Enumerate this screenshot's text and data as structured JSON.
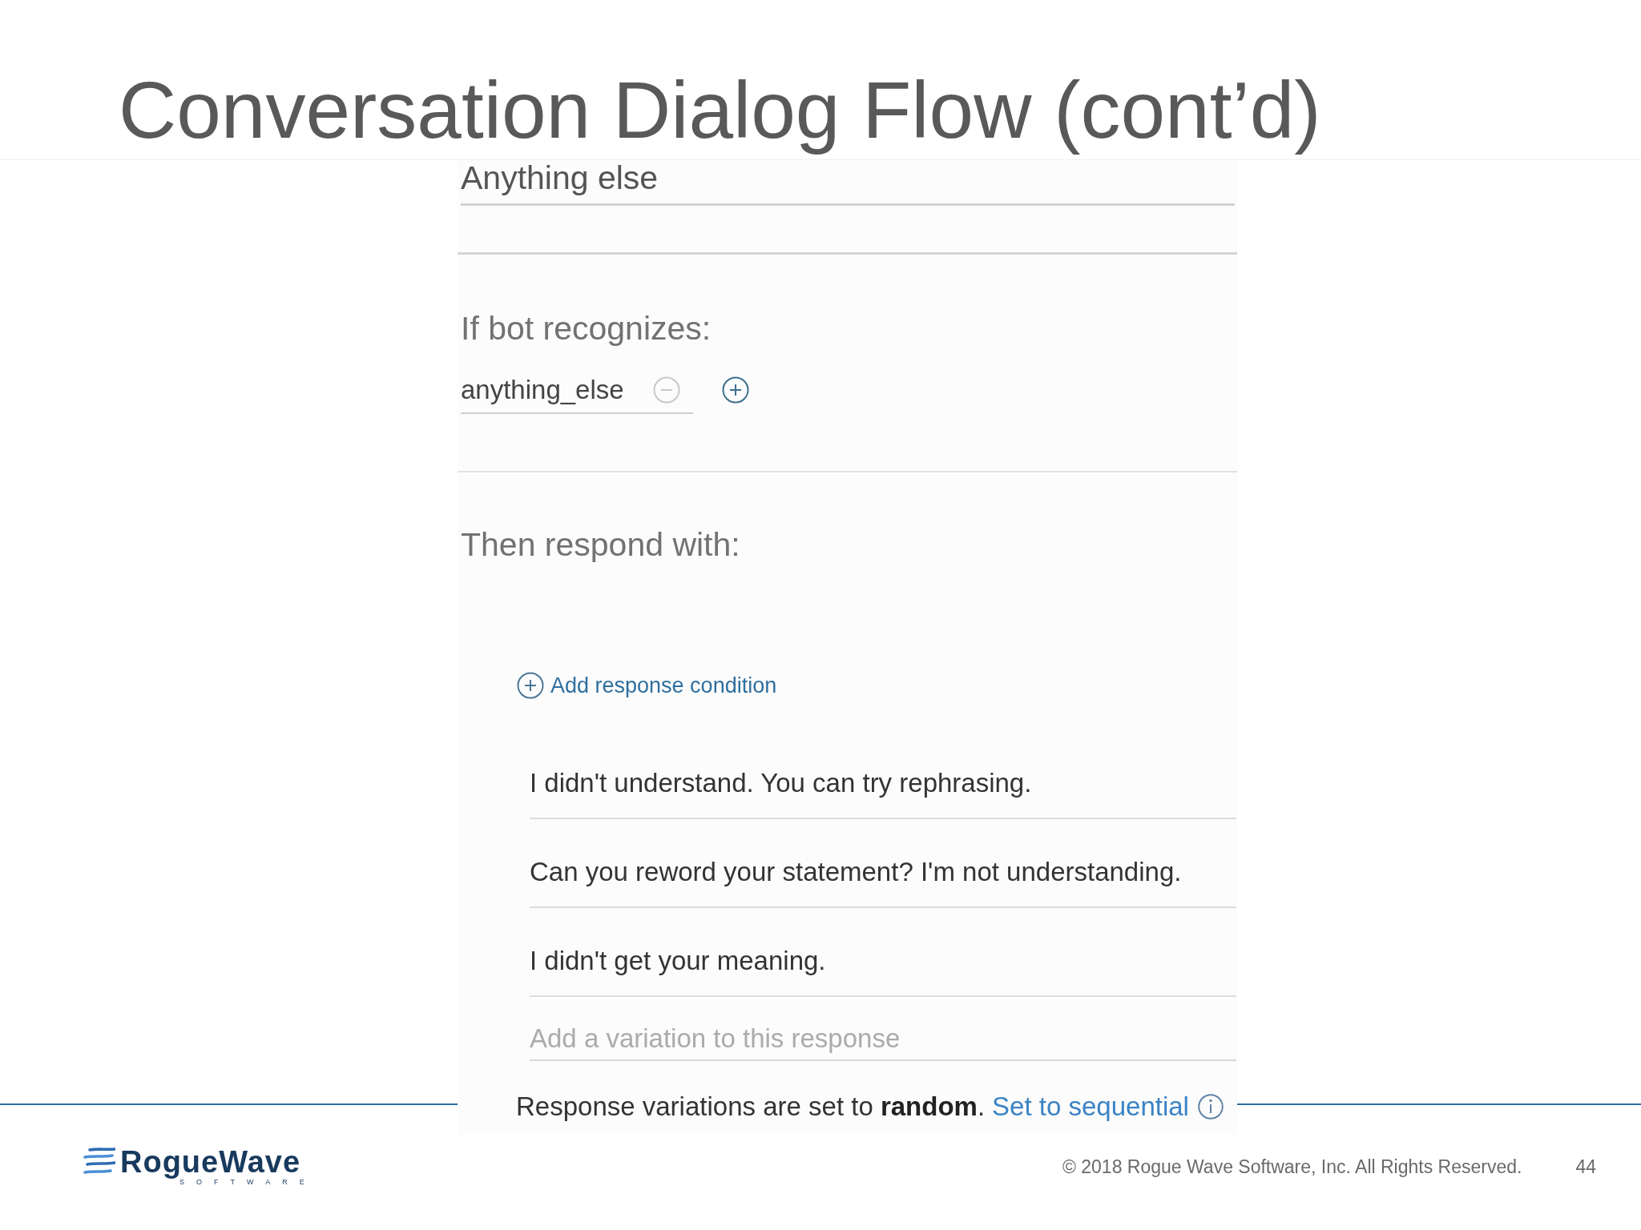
{
  "slide": {
    "title": "Conversation Dialog Flow (cont’d)"
  },
  "node_editor": {
    "node_name": {
      "value": "Anything else"
    },
    "condition_section": {
      "heading": "If bot recognizes:",
      "conditions": [
        {
          "value": "anything_else",
          "remove_button": {
            "disabled": true
          }
        }
      ]
    },
    "response_section": {
      "heading": "Then respond with:",
      "add_condition_link": "Add response condition",
      "variations": [
        {
          "value": "I didn't understand. You can try rephrasing."
        },
        {
          "value": "Can you reword your statement? I'm not understanding."
        },
        {
          "value": "I didn't get your meaning."
        }
      ],
      "new_variation": {
        "placeholder": "Add a variation to this response"
      },
      "variation_mode": {
        "text": "Response variations are set to **random**.",
        "link": "Set to sequential"
      }
    }
  },
  "footer": {
    "logo": {
      "wordmark": "RogueWave",
      "tagline": "SOFTWARE"
    },
    "copyright": "© 2018 Rogue Wave Software, Inc. All Rights Reserved.",
    "page_number": "44"
  }
}
